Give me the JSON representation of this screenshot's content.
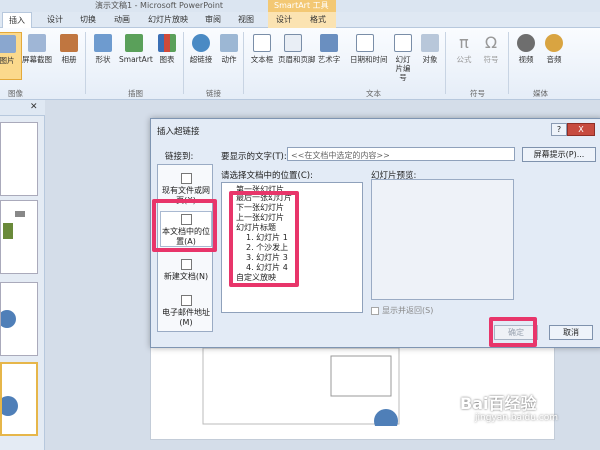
{
  "window": {
    "title": "演示文稿1 - Microsoft PowerPoint",
    "context_tab": "SmartArt 工具"
  },
  "tabs": [
    {
      "label": "插入",
      "active": true
    },
    {
      "label": "设计"
    },
    {
      "label": "切换"
    },
    {
      "label": "动画"
    },
    {
      "label": "幻灯片放映"
    },
    {
      "label": "审阅"
    },
    {
      "label": "视图"
    },
    {
      "label": "设计",
      "contextual": true
    },
    {
      "label": "格式",
      "contextual": true
    }
  ],
  "ribbon": {
    "buttons": [
      {
        "label": "图片",
        "icon": "picture-icon"
      },
      {
        "label": "屏幕截图",
        "icon": "screenshot-icon"
      },
      {
        "label": "相册",
        "icon": "album-icon"
      },
      {
        "label": "形状",
        "icon": "shapes-icon"
      },
      {
        "label": "SmartArt",
        "icon": "smartart-icon"
      },
      {
        "label": "图表",
        "icon": "chart-icon"
      },
      {
        "label": "超链接",
        "icon": "hyperlink-icon"
      },
      {
        "label": "动作",
        "icon": "action-icon"
      },
      {
        "label": "文本框",
        "icon": "textbox-icon"
      },
      {
        "label": "页眉和页脚",
        "icon": "header-footer-icon"
      },
      {
        "label": "艺术字",
        "icon": "wordart-icon"
      },
      {
        "label": "日期和时间",
        "icon": "datetime-icon"
      },
      {
        "label": "幻灯片编号",
        "icon": "slide-number-icon"
      },
      {
        "label": "对象",
        "icon": "object-icon"
      },
      {
        "label": "公式",
        "icon": "equation-icon"
      },
      {
        "label": "符号",
        "icon": "symbol-icon"
      },
      {
        "label": "视频",
        "icon": "video-icon"
      },
      {
        "label": "音频",
        "icon": "audio-icon"
      }
    ],
    "groups": [
      "图像",
      "插图",
      "链接",
      "文本",
      "符号",
      "媒体"
    ]
  },
  "dialog": {
    "title": "插入超链接",
    "help": "?",
    "close": "X",
    "link_to": "链接到:",
    "display_text_label": "要显示的文字(T):",
    "display_text_value": "<<在文档中选定的内容>>",
    "screentip": "屏幕提示(P)...",
    "place_label": "请选择文档中的位置(C):",
    "preview_label": "幻灯片预览:",
    "link_options": [
      {
        "label": "现有文件或网页(X)"
      },
      {
        "label": "本文档中的位置(A)",
        "selected": true
      },
      {
        "label": "新建文档(N)"
      },
      {
        "label": "电子邮件地址(M)"
      }
    ],
    "places": [
      "第一张幻灯片",
      "最后一张幻灯片",
      "下一张幻灯片",
      "上一张幻灯片",
      "幻灯片标题",
      "1. 幻灯片 1",
      "2. 个沙发上",
      "3. 幻灯片 3",
      "4. 幻灯片 4",
      "自定义放映"
    ],
    "show_return": "显示并返回(S)",
    "ok": "确定",
    "cancel": "取消"
  },
  "watermark": {
    "brand": "Bai百经验",
    "url": "jingyan.baidu.com"
  },
  "colors": {
    "highlight": "#e8356a",
    "accent": "#fbd98c"
  }
}
